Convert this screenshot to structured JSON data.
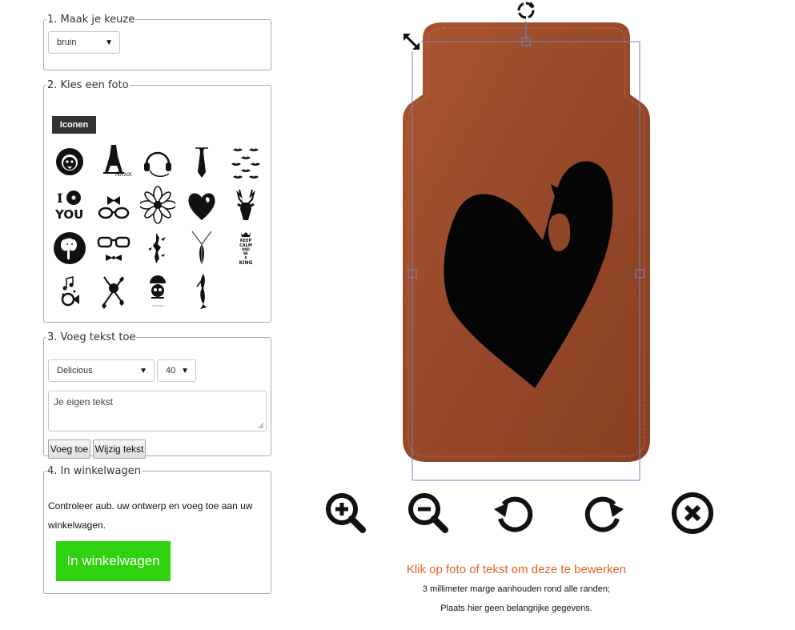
{
  "panel1": {
    "legend": "1. Maak je keuze",
    "color_select": "bruin"
  },
  "panel2": {
    "legend": "2. Kies een foto",
    "tab": "Iconen",
    "icons": [
      "lion-head-icon",
      "eiffel-tower-amour-icon",
      "headphones-icon",
      "necktie-icon",
      "mustache-collection-icon",
      "i-love-you-record-icon",
      "bow-glasses-icon",
      "flower-mandala-icon",
      "heart-icon",
      "deer-head-icon",
      "elephant-circle-icon",
      "hipster-glasses-bowtie-icon",
      "birds-silhouette-icon",
      "feather-necklace-icon",
      "keep-calm-king-icon",
      "musical-horn-icon",
      "skull-crossbones-cards-icon",
      "skull-parachute-icon",
      "mermaid-silhouette-icon"
    ],
    "keep_calm_lines": [
      "KEEP",
      "CALM",
      "AND",
      "BE",
      "A",
      "KING"
    ],
    "i_you_letters": [
      "I",
      "YOU"
    ]
  },
  "panel3": {
    "legend": "3. Voeg tekst toe",
    "font_select": "Delicious",
    "size_select": "40",
    "text_placeholder": "Je eigen tekst",
    "add_button": "Voeg toe",
    "edit_button": "Wijzig tekst"
  },
  "panel4": {
    "legend": "4. In winkelwagen",
    "description": "Controleer aub. uw ontwerp en voeg toe aan uw winkelwagen.",
    "cart_button": "In winkelwagen"
  },
  "canvas": {
    "product_color": "#9b4a2a",
    "toolbar": [
      "zoom-in-icon",
      "zoom-out-icon",
      "rotate-left-icon",
      "rotate-right-icon",
      "remove-icon"
    ]
  },
  "messages": {
    "edit_hint": "Klik op foto of tekst om deze te bewerken",
    "margin_note": "3 millimeter marge aanhouden rond alle randen;",
    "info_note": "Plaats hier geen belangrijke gegevens."
  },
  "colors": {
    "accent_orange": "#e0642a",
    "cart_green": "#2ed20e",
    "tab_dark": "#333333"
  }
}
